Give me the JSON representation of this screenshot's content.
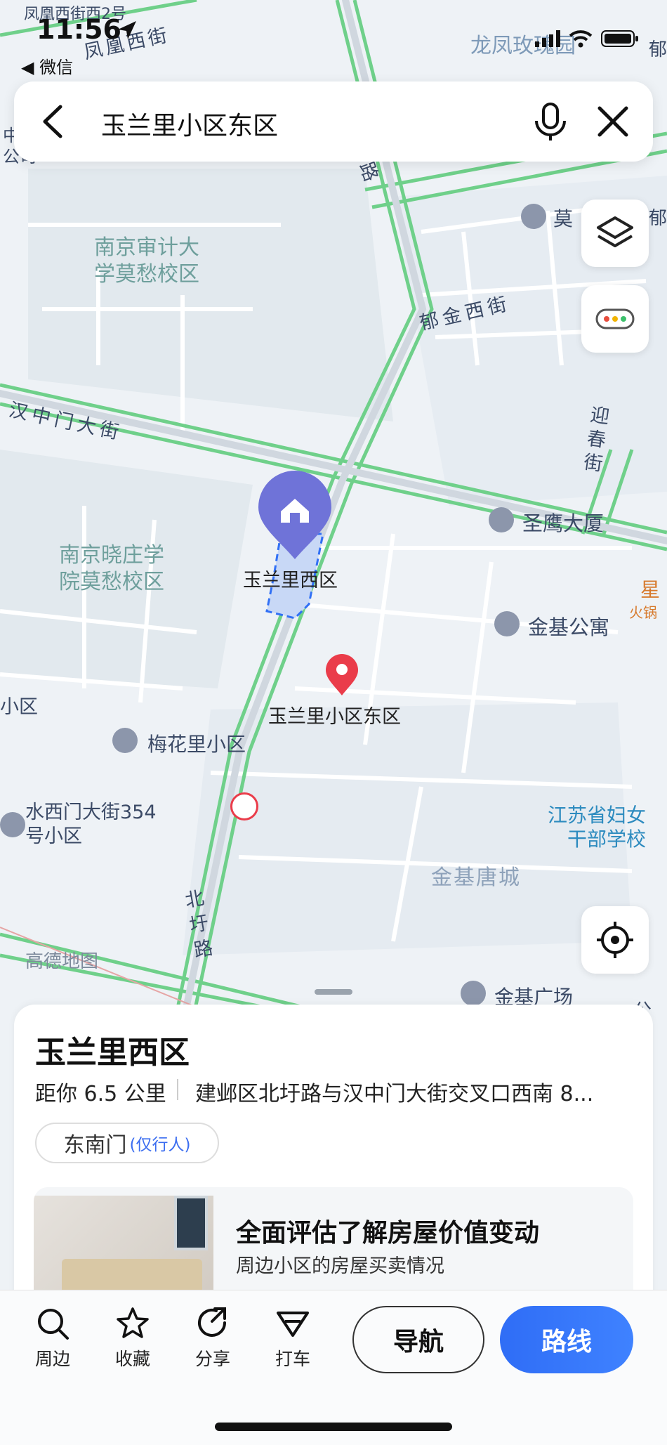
{
  "status_bar": {
    "time": "11:56",
    "back_app": "◀ 微信"
  },
  "search": {
    "query": "玉兰里小区东区"
  },
  "map": {
    "roads": [
      "凤凰西街",
      "郁金西街",
      "汉中门大街",
      "迎春街",
      "北圩路",
      "路"
    ],
    "places": {
      "school1": "南京审计大\n学莫愁校区",
      "school2": "南京晓庄学\n院莫愁校区",
      "yulanli_west": "玉兰里西区",
      "yulanli_east": "玉兰里小区东区",
      "shengying": "圣鹰大厦",
      "jinji_gongyu": "金基公寓",
      "meihuali": "梅花里小区",
      "shuiximen": "水西门大街354\n号小区",
      "women_school": "江苏省妇女\n干部学校",
      "jinji_tangcheng": "金基唐城",
      "jinji_guangchang": "金基广场",
      "longfeng": "龙凤玫瑰园",
      "mo": "莫",
      "xiaoqu": "小区",
      "xing": "星",
      "huoguo": "火锅",
      "top_partial": "凤凰西街西2号",
      "right_partial1": "郁",
      "left_partial": "中\n公司",
      "right_partial2": "郁",
      "right_partial3": "公"
    },
    "watermark": "高德地图"
  },
  "place_panel": {
    "name": "玉兰里西区",
    "distance": "距你 6.5 公里",
    "address": "建邺区北圩路与汉中门大街交叉口西南 8...",
    "gate": "东南门",
    "gate_note": "(仅行人)",
    "promo_title": "全面评估了解房屋价值变动",
    "promo_sub": "周边小区的房屋买卖情况"
  },
  "toolbar": {
    "nearby": "周边",
    "favorite": "收藏",
    "share": "分享",
    "taxi": "打车",
    "navigate": "导航",
    "route": "路线"
  },
  "colors": {
    "route_blue": "#3170f5",
    "marker_red": "#ea3c4a",
    "road_green": "#6fd08a",
    "poi_purple": "#7b7fd8"
  }
}
